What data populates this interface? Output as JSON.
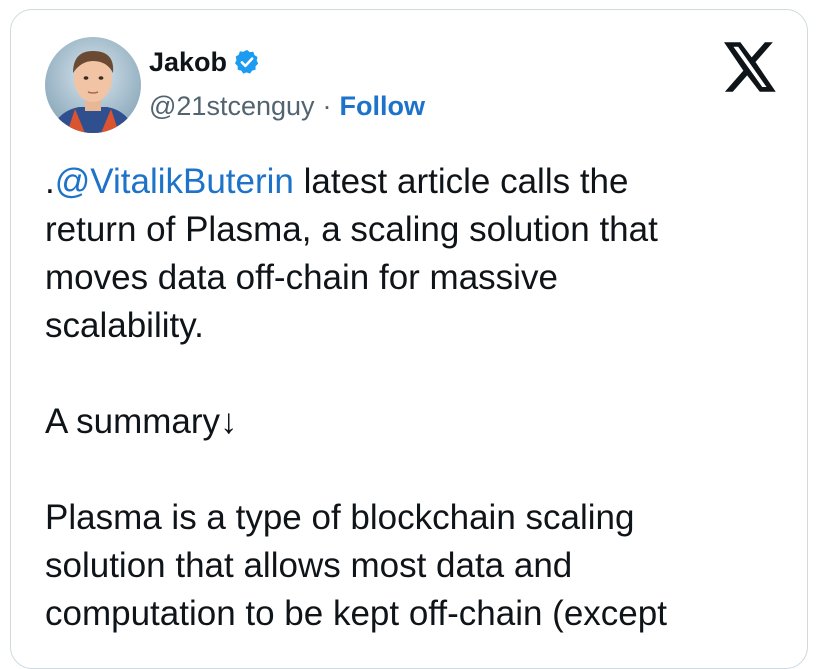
{
  "tweet": {
    "author": {
      "name": "Jakob",
      "verified": true,
      "handle": "@21stcenguy",
      "separator": "·",
      "follow_label": "Follow"
    },
    "platform_logo": "x-logo-icon",
    "text": {
      "line1_prefix": ".",
      "line1_mention": "@VitalikButerin",
      "line1_rest": " latest article calls the",
      "line2": "return of Plasma, a scaling solution that",
      "line3": "moves data off-chain for massive",
      "line4": "scalability.",
      "line5": "A summary↓",
      "line6": "Plasma is a type of blockchain scaling",
      "line7": "solution that allows most data and",
      "line8": "computation to be kept off-chain (except"
    }
  },
  "colors": {
    "link": "#1d73c9",
    "verified_badge": "#1d9bf0",
    "text": "#0f1419",
    "secondary_text": "#536471",
    "border": "#cfd9de"
  }
}
